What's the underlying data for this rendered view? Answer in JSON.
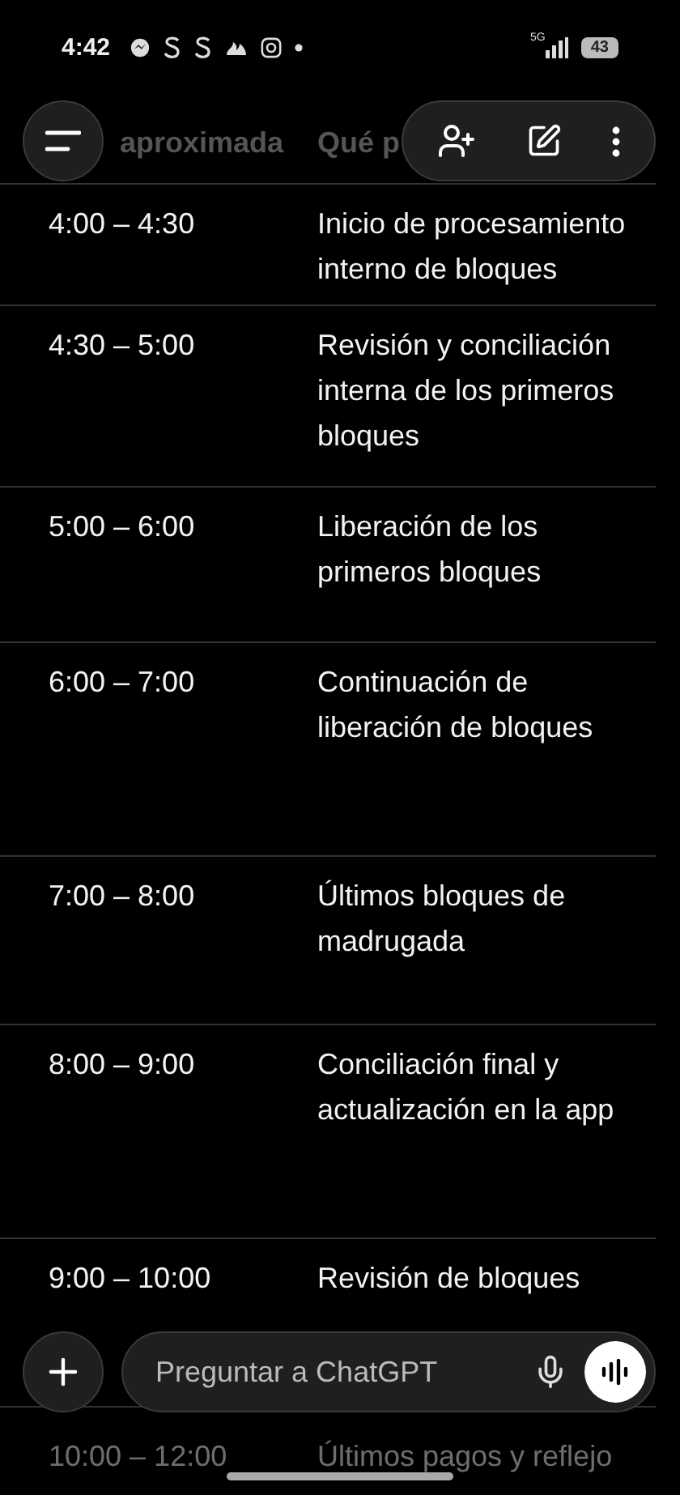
{
  "status_bar": {
    "time": "4:42",
    "network": "5G",
    "battery": "43"
  },
  "table": {
    "columns": [
      "aproximada",
      "Qué p"
    ],
    "rows": [
      {
        "time": "4:00 – 4:30",
        "description": "Inicio de procesamiento interno de bloques",
        "faded": false
      },
      {
        "time": "4:30 – 5:00",
        "description": "Revisión y conciliación interna de los primeros bloques",
        "faded": false
      },
      {
        "time": "5:00 – 6:00",
        "description": "Liberación de los primeros bloques",
        "faded": false
      },
      {
        "time": "6:00 – 7:00",
        "description": "Continuación de liberación de bloques",
        "faded": false
      },
      {
        "time": "7:00 – 8:00",
        "description": "Últimos bloques de madrugada",
        "faded": false
      },
      {
        "time": "8:00 – 9:00",
        "description": "Conciliación final y actualización en la app",
        "faded": false
      },
      {
        "time": "9:00 – 10:00",
        "description": "Revisión de bloques",
        "faded": false
      },
      {
        "time": "10:00 – 12:00",
        "description": "Últimos pagos y reflejo",
        "faded": true
      }
    ]
  },
  "composer": {
    "placeholder": "Preguntar a ChatGPT"
  }
}
